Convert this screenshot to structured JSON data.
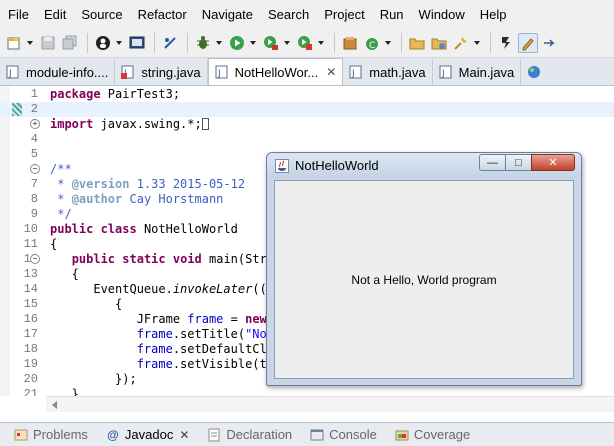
{
  "menu": [
    "File",
    "Edit",
    "Source",
    "Refactor",
    "Navigate",
    "Search",
    "Project",
    "Run",
    "Window",
    "Help"
  ],
  "tabs": [
    {
      "label": "module-info....",
      "icon": "module-file-icon",
      "active": false
    },
    {
      "label": "string.java",
      "icon": "java-error-file-icon",
      "active": false
    },
    {
      "label": "NotHelloWor...",
      "icon": "java-file-icon",
      "active": true,
      "close": "✕"
    },
    {
      "label": "math.java",
      "icon": "java-file-icon",
      "active": false
    },
    {
      "label": "Main.java",
      "icon": "java-file-icon",
      "active": false
    }
  ],
  "editor": {
    "lines": [
      {
        "n": "1",
        "html": "<span class='kw'>package</span> PairTest3;"
      },
      {
        "n": "2",
        "html": ""
      },
      {
        "n": "3",
        "fold": "+",
        "html": "<span class='kw'>import</span> javax.swing.*;<span class='caret-box'></span>"
      },
      {
        "n": "4",
        "html": ""
      },
      {
        "n": "5",
        "html": ""
      },
      {
        "n": "6",
        "fold": "−",
        "html": "<span class='cm'>/**</span>"
      },
      {
        "n": "7",
        "html": "<span class='cm'> * </span><span class='tag'>@version</span><span class='cm'> 1.33 2015-05-12</span>"
      },
      {
        "n": "8",
        "html": "<span class='cm'> * </span><span class='tag'>@author</span><span class='cm'> Cay Horstmann</span>"
      },
      {
        "n": "9",
        "html": "<span class='cm'> */</span>"
      },
      {
        "n": "10",
        "html": "<span class='kw'>public</span> <span class='kw'>class</span> NotHelloWorld"
      },
      {
        "n": "11",
        "html": "{"
      },
      {
        "n": "12",
        "fold": "−",
        "html": "   <span class='kw'>public</span> <span class='kw'>static</span> <span class='kw'>void</span> main(Stri"
      },
      {
        "n": "13",
        "html": "   {"
      },
      {
        "n": "14",
        "html": "      EventQueue.<span class='it'>invokeLater</span>(()"
      },
      {
        "n": "15",
        "html": "         {"
      },
      {
        "n": "16",
        "html": "            JFrame <span class='fld'>frame</span> = <span class='kw'>new</span>"
      },
      {
        "n": "17",
        "html": "            <span class='fld'>frame</span>.setTitle(<span class='str'>\"Not</span>"
      },
      {
        "n": "18",
        "html": "            <span class='fld'>frame</span>.setDefaultClo"
      },
      {
        "n": "19",
        "html": "            <span class='fld'>frame</span>.setVisible(tr"
      },
      {
        "n": "20",
        "html": "         });"
      },
      {
        "n": "21",
        "html": "   }"
      },
      {
        "n": "22",
        "html": "}"
      }
    ]
  },
  "views": [
    {
      "label": "Problems",
      "icon": "problems-icon",
      "active": false
    },
    {
      "label": "Javadoc",
      "icon": "javadoc-icon",
      "active": true,
      "close": "✕"
    },
    {
      "label": "Declaration",
      "icon": "declaration-icon",
      "active": false
    },
    {
      "label": "Console",
      "icon": "console-icon",
      "active": false
    },
    {
      "label": "Coverage",
      "icon": "coverage-icon",
      "active": false
    }
  ],
  "frame": {
    "title": "NotHelloWorld",
    "message": "Not a Hello, World program",
    "buttons": {
      "minimize": "—",
      "maximize": "□",
      "close": "✕"
    }
  },
  "colors": {
    "keyword": "#7f0055",
    "comment": "#3f5fbf",
    "string": "#2a00ff",
    "field": "#0000c0",
    "current_line": "#e8f2fe"
  }
}
